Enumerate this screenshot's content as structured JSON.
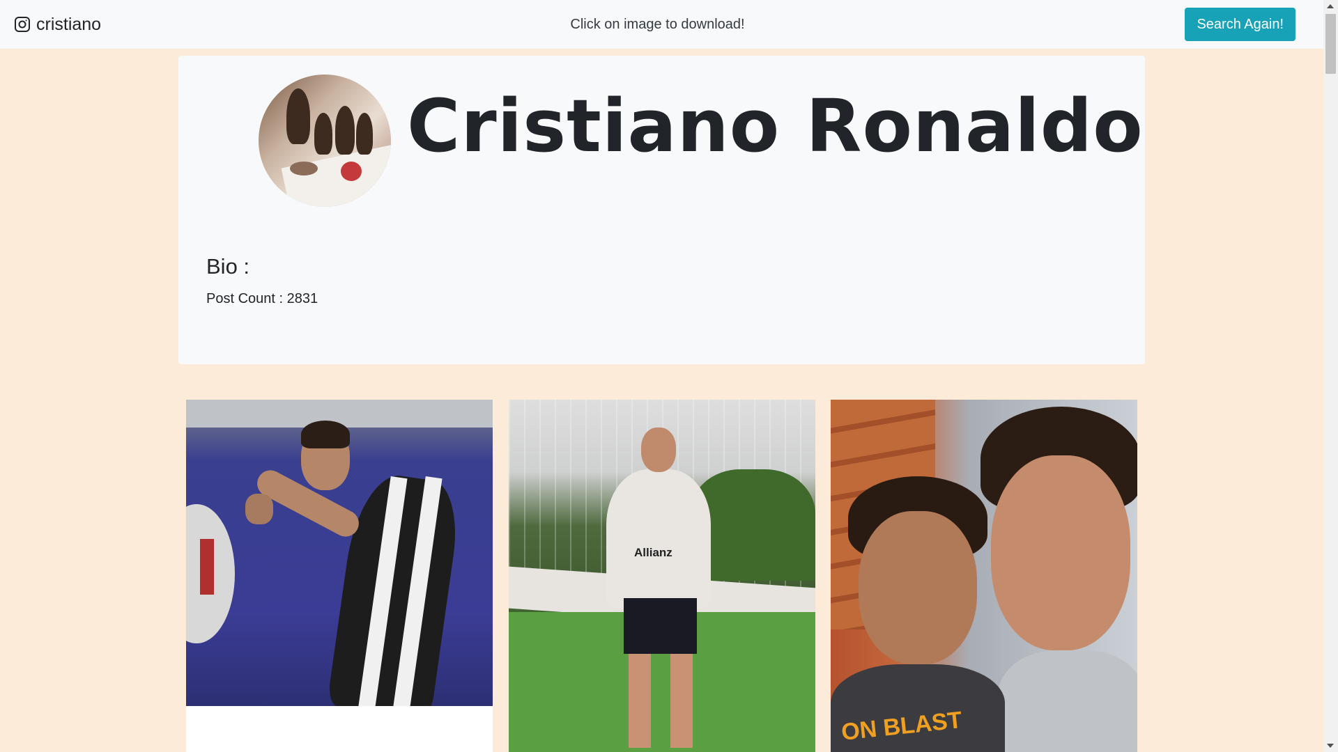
{
  "navbar": {
    "brand_icon": "instagram-icon",
    "username": "cristiano",
    "hint": "Click on image to download!",
    "search_again_label": "Search Again!"
  },
  "profile": {
    "full_name": "Cristiano Ronaldo",
    "bio_heading": "Bio :",
    "post_count_text": "Post Count : 2831"
  },
  "posts": [
    {
      "logo_text": ""
    },
    {
      "logo_text": "Allianz"
    },
    {
      "logo_text": "ON BLAST"
    }
  ],
  "colors": {
    "page_background": "#fbebd8",
    "navbar_background": "#f8f9fa",
    "card_background": "#f8f9fa",
    "button_accent": "#17a2b8",
    "text": "#212529"
  }
}
